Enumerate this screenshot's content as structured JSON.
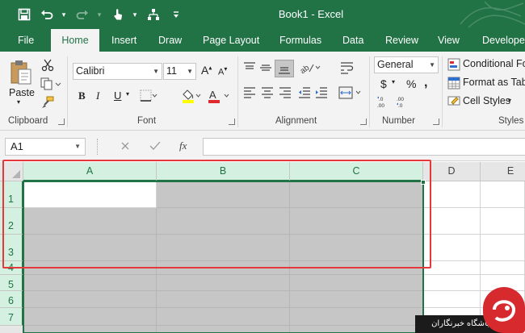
{
  "window": {
    "title": "Book1 - Excel"
  },
  "tabs": [
    {
      "label": "File"
    },
    {
      "label": "Home",
      "active": true
    },
    {
      "label": "Insert"
    },
    {
      "label": "Draw"
    },
    {
      "label": "Page Layout"
    },
    {
      "label": "Formulas"
    },
    {
      "label": "Data"
    },
    {
      "label": "Review"
    },
    {
      "label": "View"
    },
    {
      "label": "Developer"
    }
  ],
  "ribbon": {
    "clipboard": {
      "label": "Clipboard",
      "paste": "Paste"
    },
    "font": {
      "label": "Font",
      "name": "Calibri",
      "size": "11"
    },
    "alignment": {
      "label": "Alignment"
    },
    "number": {
      "label": "Number",
      "format": "General"
    },
    "styles": {
      "label": "Styles",
      "conditional": "Conditional Fo",
      "format_table": "Format as Tabl",
      "cell_styles": "Cell Styles"
    }
  },
  "formula_bar": {
    "name_box": "A1",
    "fx": "fx",
    "value": ""
  },
  "grid": {
    "columns": [
      "A",
      "B",
      "C",
      "D",
      "E"
    ],
    "rows": [
      "1",
      "2",
      "3",
      "4",
      "5",
      "6",
      "7"
    ],
    "active_cell": "A1",
    "selection": "A1:C7"
  },
  "watermark": {
    "text": "باشگاه خبرنگاران"
  },
  "colors": {
    "accent": "#217346",
    "highlight": "#e5383b",
    "selection": "#c6c6c6"
  }
}
